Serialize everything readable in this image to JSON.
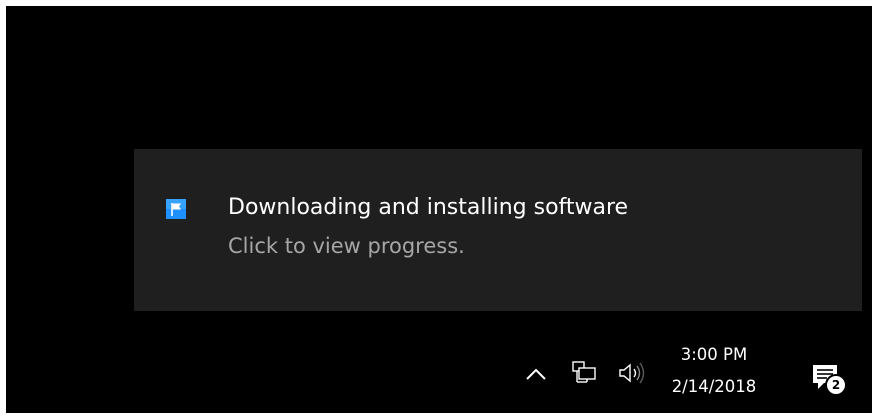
{
  "notification": {
    "title": "Downloading and installing software",
    "body": "Click to view progress.",
    "icon": "windows-update-flag-icon"
  },
  "tray": {
    "icons": [
      "chevron-up-icon",
      "network-icon",
      "volume-icon"
    ],
    "clock": {
      "time": "3:00 PM",
      "date": "2/14/2018"
    },
    "action_center": {
      "icon": "action-center-icon",
      "badge_count": "2"
    }
  },
  "colors": {
    "desktop_background": "#000000",
    "toast_background": "#1f1f1f",
    "title_text": "#ffffff",
    "body_text": "#a6a6a6",
    "icon_accent": "#1e90ff"
  }
}
